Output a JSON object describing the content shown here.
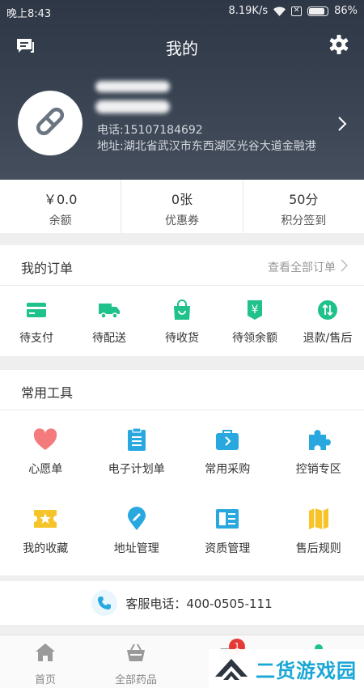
{
  "status_bar": {
    "time": "晚上8:43",
    "speed": "8.19K/s",
    "battery": "86%",
    "battery_level": 0.86
  },
  "header": {
    "title": "我的"
  },
  "profile": {
    "phone": "电话:15107184692",
    "address": "地址:湖北省武汉市东西湖区光谷大道金融港"
  },
  "stats": [
    {
      "value": "￥0.0",
      "label": "余额"
    },
    {
      "value": "0张",
      "label": "优惠券"
    },
    {
      "value": "50分",
      "label": "积分签到"
    }
  ],
  "orders": {
    "title": "我的订单",
    "view_all": "查看全部订单",
    "items": [
      {
        "label": "待支付",
        "icon": "card-icon"
      },
      {
        "label": "待配送",
        "icon": "truck-icon"
      },
      {
        "label": "待收货",
        "icon": "bag-icon"
      },
      {
        "label": "待领余额",
        "icon": "yen-tag-icon"
      },
      {
        "label": "退款/售后",
        "icon": "refund-icon"
      }
    ]
  },
  "tools": {
    "title": "常用工具",
    "items": [
      {
        "label": "心愿单",
        "icon": "heart-icon"
      },
      {
        "label": "电子计划单",
        "icon": "clipboard-icon"
      },
      {
        "label": "常用采购",
        "icon": "briefcase-icon"
      },
      {
        "label": "控销专区",
        "icon": "puzzle-icon"
      },
      {
        "label": "我的收藏",
        "icon": "star-ticket-icon"
      },
      {
        "label": "地址管理",
        "icon": "location-pin-icon"
      },
      {
        "label": "资质管理",
        "icon": "document-icon"
      },
      {
        "label": "售后规则",
        "icon": "map-icon"
      }
    ]
  },
  "service": {
    "text": "客服电话：400-0505-111"
  },
  "tabbar": {
    "items": [
      {
        "label": "首页"
      },
      {
        "label": "全部药品"
      }
    ],
    "badge": "1"
  },
  "watermark": {
    "text": "二货游戏园"
  },
  "colors": {
    "green": "#1fc28a",
    "blue": "#29a8e0",
    "header_bg": "#353f4e",
    "badge": "#e53935"
  }
}
